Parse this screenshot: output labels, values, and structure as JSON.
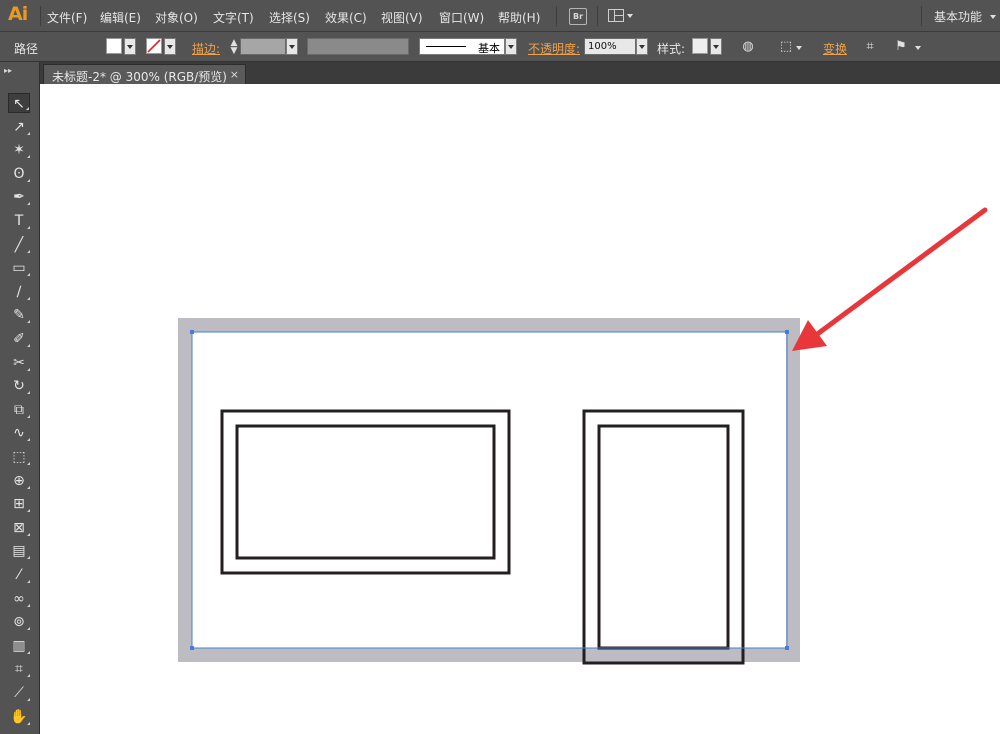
{
  "app": {
    "logo": "Ai"
  },
  "menu": [
    {
      "label": "文件(F)"
    },
    {
      "label": "编辑(E)"
    },
    {
      "label": "对象(O)"
    },
    {
      "label": "文字(T)"
    },
    {
      "label": "选择(S)"
    },
    {
      "label": "效果(C)"
    },
    {
      "label": "视图(V)"
    },
    {
      "label": "窗口(W)"
    },
    {
      "label": "帮助(H)"
    }
  ],
  "bridge_button": {
    "label": "Br"
  },
  "workspace": {
    "label": "基本功能"
  },
  "control": {
    "selection_type": "路径",
    "stroke_label": "描边:",
    "stroke_style": "基本",
    "opacity_label": "不透明度:",
    "opacity_value": "100%",
    "style_label": "样式:",
    "transform_label": "变换"
  },
  "document_tab": {
    "title": "未标题-2* @ 300% (RGB/预览)",
    "close": "×"
  },
  "tools": [
    {
      "name": "selection-tool-icon",
      "glyph": "↖"
    },
    {
      "name": "direct-selection-tool-icon",
      "glyph": "↗"
    },
    {
      "name": "magic-wand-tool-icon",
      "glyph": "✶"
    },
    {
      "name": "lasso-tool-icon",
      "glyph": "ʘ"
    },
    {
      "name": "pen-tool-icon",
      "glyph": "✒"
    },
    {
      "name": "type-tool-icon",
      "glyph": "T"
    },
    {
      "name": "line-tool-icon",
      "glyph": "╱"
    },
    {
      "name": "rectangle-tool-icon",
      "glyph": "▭"
    },
    {
      "name": "paintbrush-tool-icon",
      "glyph": "∕"
    },
    {
      "name": "pencil-tool-icon",
      "glyph": "✎"
    },
    {
      "name": "blob-brush-tool-icon",
      "glyph": "✐"
    },
    {
      "name": "scissors-tool-icon",
      "glyph": "✂"
    },
    {
      "name": "rotate-tool-icon",
      "glyph": "↻"
    },
    {
      "name": "scale-tool-icon",
      "glyph": "⧉"
    },
    {
      "name": "warp-tool-icon",
      "glyph": "∿"
    },
    {
      "name": "free-transform-tool-icon",
      "glyph": "⬚"
    },
    {
      "name": "shape-builder-tool-icon",
      "glyph": "⊕"
    },
    {
      "name": "perspective-grid-tool-icon",
      "glyph": "⊞"
    },
    {
      "name": "mesh-tool-icon",
      "glyph": "⊠"
    },
    {
      "name": "gradient-tool-icon",
      "glyph": "▤"
    },
    {
      "name": "eyedropper-tool-icon",
      "glyph": "⁄"
    },
    {
      "name": "blend-tool-icon",
      "glyph": "∞"
    },
    {
      "name": "symbol-sprayer-tool-icon",
      "glyph": "⊚"
    },
    {
      "name": "column-graph-tool-icon",
      "glyph": "▥"
    },
    {
      "name": "artboard-tool-icon",
      "glyph": "⌗"
    },
    {
      "name": "slice-tool-icon",
      "glyph": "⟋"
    },
    {
      "name": "hand-tool-icon",
      "glyph": "✋"
    }
  ],
  "colors": {
    "arrow": "#e8373a",
    "selection": "#4a7bd6",
    "artboard_border": "#bcbcc2"
  }
}
